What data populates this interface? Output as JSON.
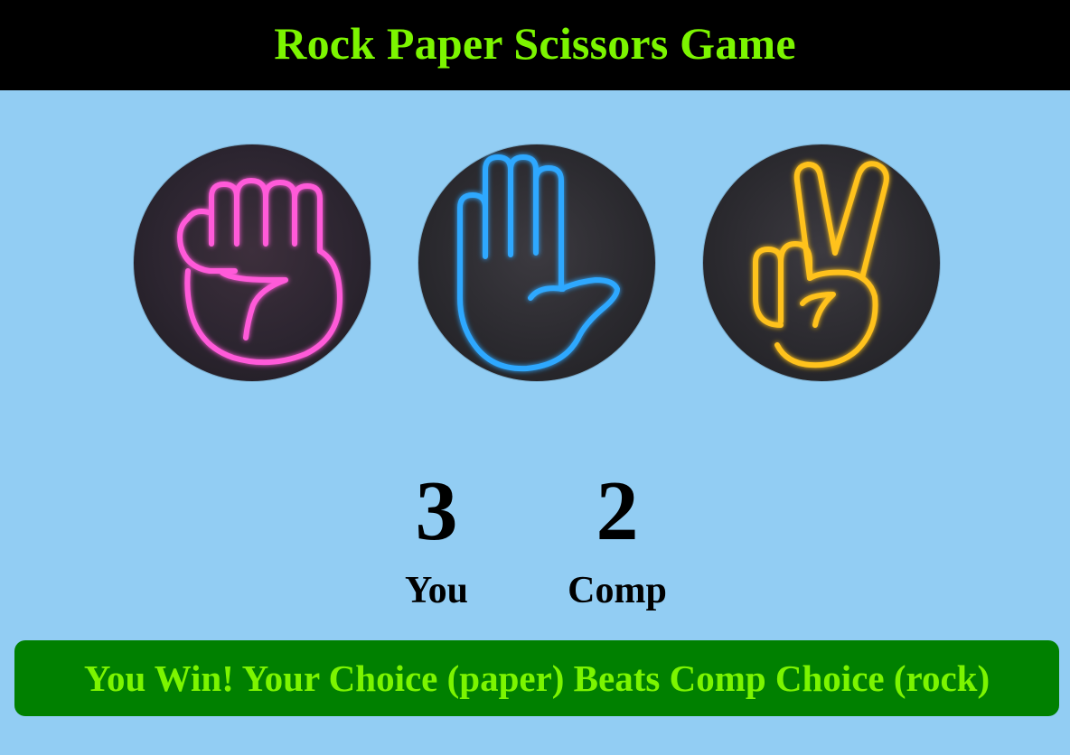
{
  "header": {
    "title": "Rock Paper Scissors Game"
  },
  "choices": [
    {
      "id": "rock",
      "icon": "rock-fist-icon",
      "neon_color": "#ff4fd8"
    },
    {
      "id": "paper",
      "icon": "paper-hand-icon",
      "neon_color": "#2fa6ff"
    },
    {
      "id": "scissors",
      "icon": "scissors-v-sign-icon",
      "neon_color": "#ffc21a"
    }
  ],
  "scores": {
    "user": {
      "value": "3",
      "label": "You"
    },
    "comp": {
      "value": "2",
      "label": "Comp"
    }
  },
  "message": {
    "text": "You Win! Your Choice (paper) Beats Comp Choice (rock)",
    "background": "#008000",
    "color": "#7cf500"
  },
  "colors": {
    "page_background": "#92cdf3",
    "header_background": "#000000",
    "title_color": "#7cf500"
  }
}
